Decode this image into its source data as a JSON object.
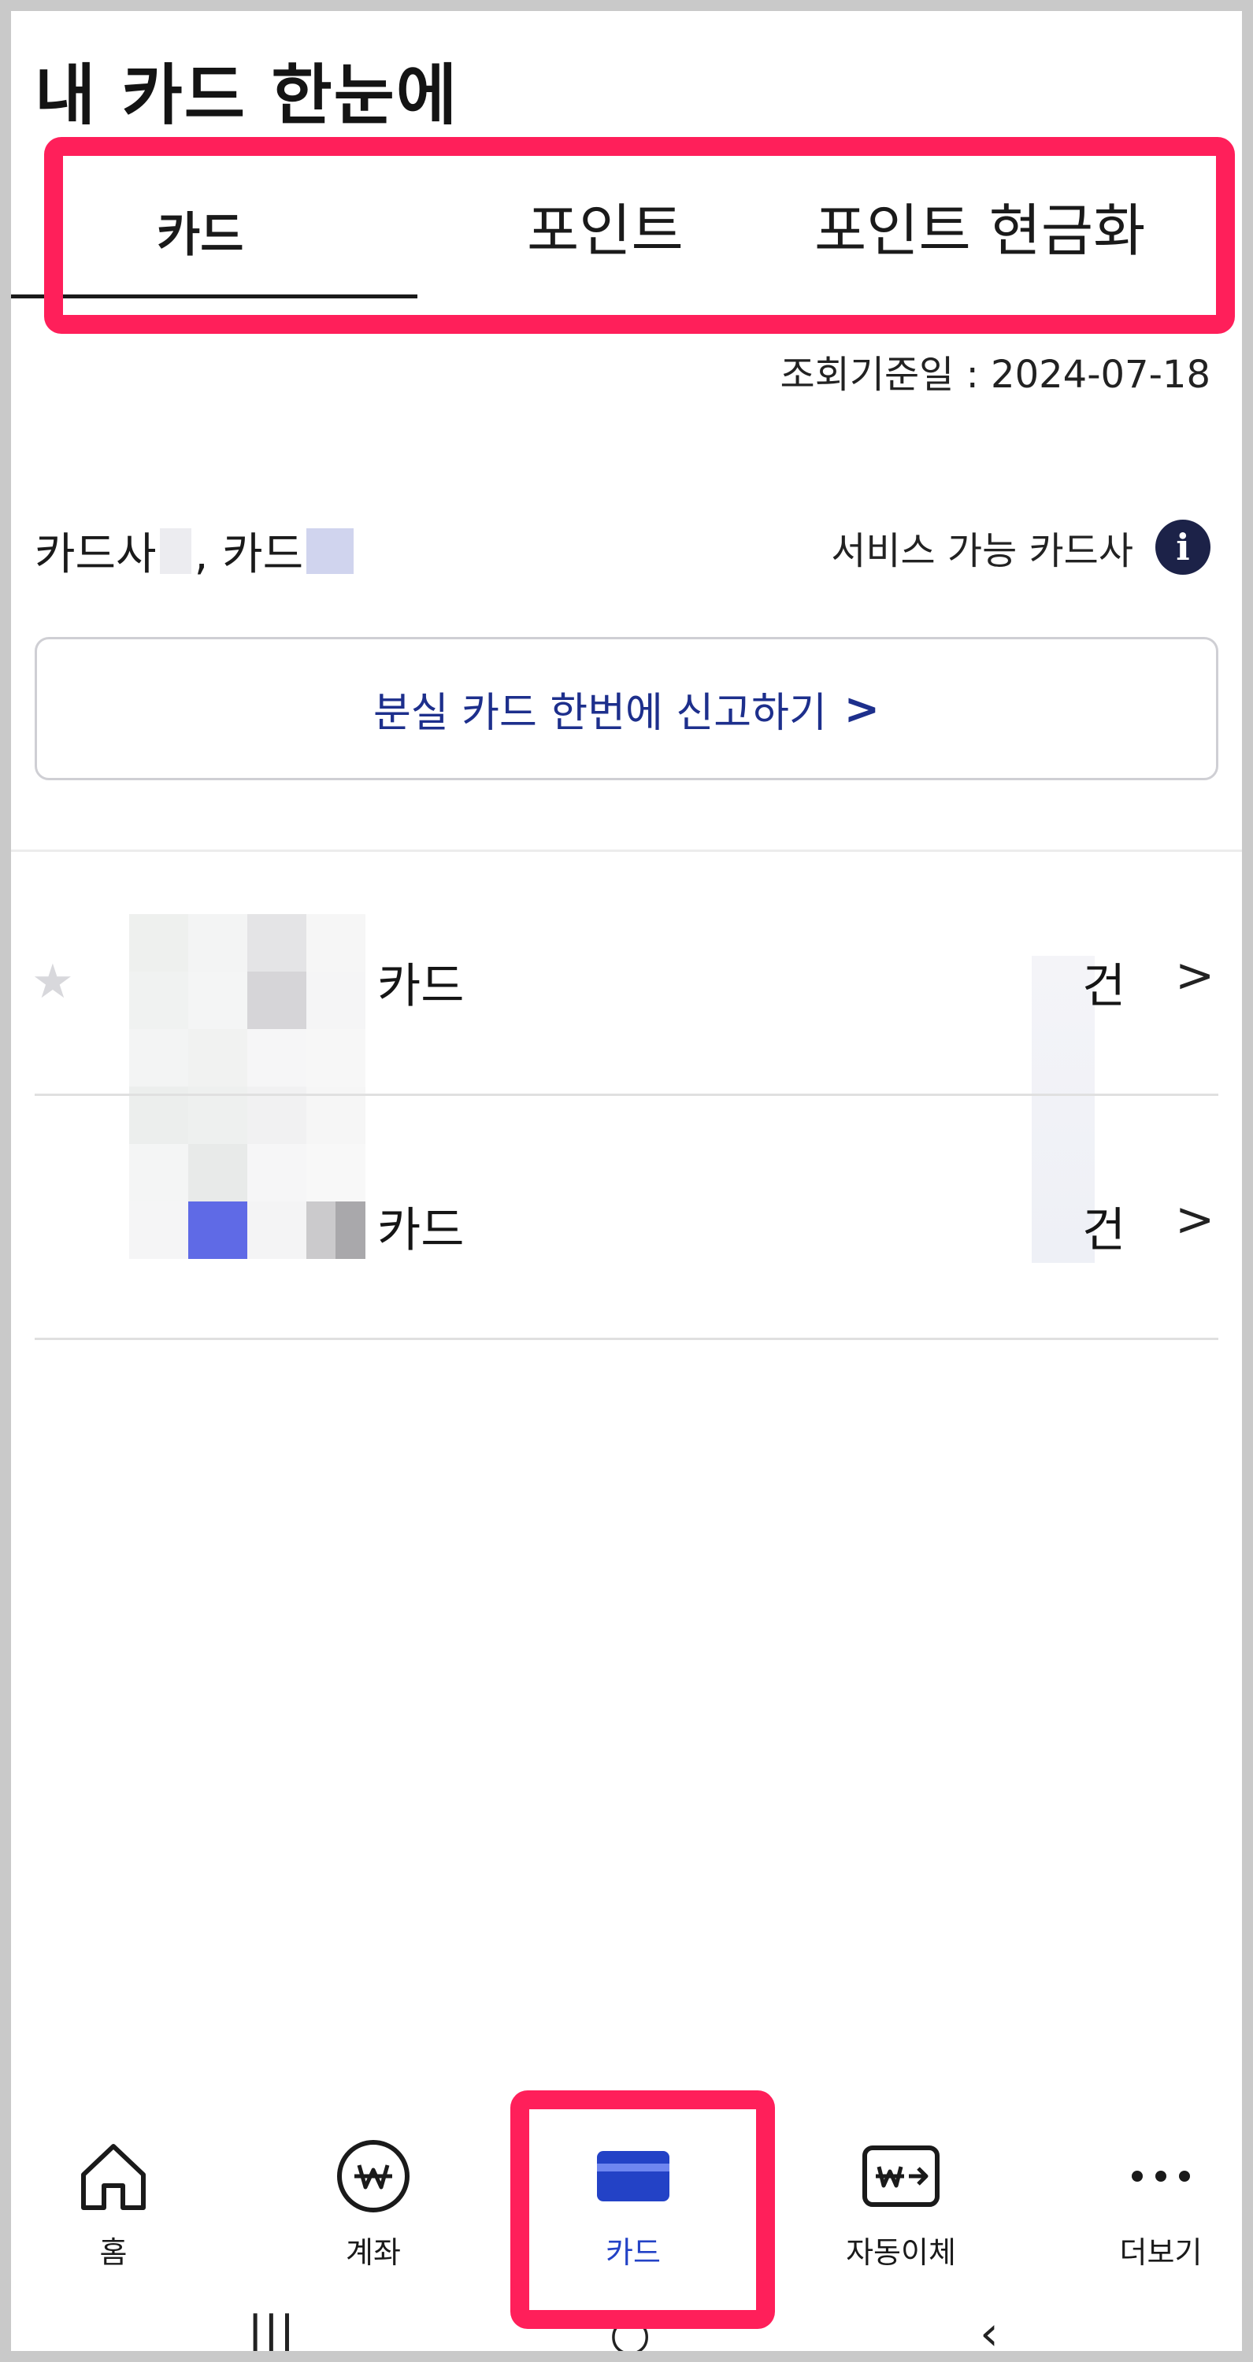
{
  "page": {
    "title": "내 카드 한눈에"
  },
  "tabs": [
    {
      "label": "카드",
      "active": true
    },
    {
      "label": "포인트",
      "active": false
    },
    {
      "label": "포인트 현금화",
      "active": false
    }
  ],
  "query_date": "조회기준일 : 2024-07-18",
  "summary": {
    "issuer_prefix": "카드사",
    "card_prefix": ", 카드"
  },
  "service": {
    "label": "서비스 가능 카드사",
    "icon": "info-icon"
  },
  "report_button": {
    "label": "분실 카드 한번에 신고하기",
    "chevron": ">"
  },
  "card_list": [
    {
      "name": "카드",
      "count_suffix": "건",
      "chevron": ">",
      "icon": "star-icon"
    },
    {
      "name": "카드",
      "count_suffix": "건",
      "chevron": ">"
    }
  ],
  "bottom_nav": [
    {
      "label": "홈",
      "icon": "home-icon"
    },
    {
      "label": "계좌",
      "icon": "won-coin-icon"
    },
    {
      "label": "카드",
      "icon": "card-icon",
      "active": true
    },
    {
      "label": "자동이체",
      "icon": "auto-transfer-icon"
    },
    {
      "label": "더보기",
      "icon": "more-dots-icon"
    }
  ],
  "colors": {
    "highlight": "#ff1f5a",
    "accent_blue": "#2342c6",
    "link_navy": "#1d2f8c"
  }
}
